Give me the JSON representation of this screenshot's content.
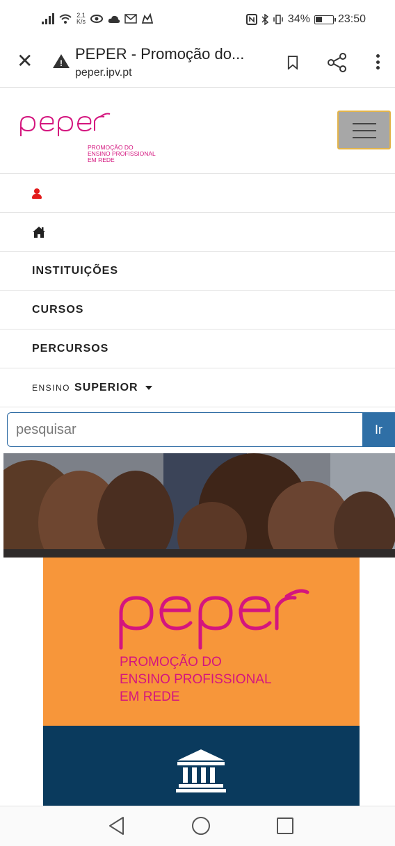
{
  "status_bar": {
    "speed_value": "2,1",
    "speed_unit": "K/s",
    "battery_text": "34%",
    "time": "23:50"
  },
  "tab": {
    "title": "PEPER - Promoção do...",
    "url": "peper.ipv.pt"
  },
  "site": {
    "logo_word": "peper",
    "logo_subtitle_lines": [
      "PROMOÇÃO DO",
      "ENSINO PROFISSIONAL",
      "EM REDE"
    ]
  },
  "nav": {
    "institutions": "INSTITUIÇÕES",
    "courses": "CURSOS",
    "paths": "PERCURSOS",
    "ensino_prefix": "ENSINO",
    "ensino_level": "SUPERIOR"
  },
  "search": {
    "placeholder": "pesquisar",
    "button_label": "Ir"
  },
  "banner": {
    "logo_word": "peper",
    "subtitle_line1": "PROMOÇÃO DO",
    "subtitle_line2": "ENSINO PROFISSIONAL",
    "subtitle_line3": "EM REDE"
  },
  "colors": {
    "brand_pink": "#d4157e",
    "orange": "#f7963a",
    "navy": "#0a3a5d",
    "search_blue": "#2f6fa6",
    "user_red": "#e21c1c"
  }
}
